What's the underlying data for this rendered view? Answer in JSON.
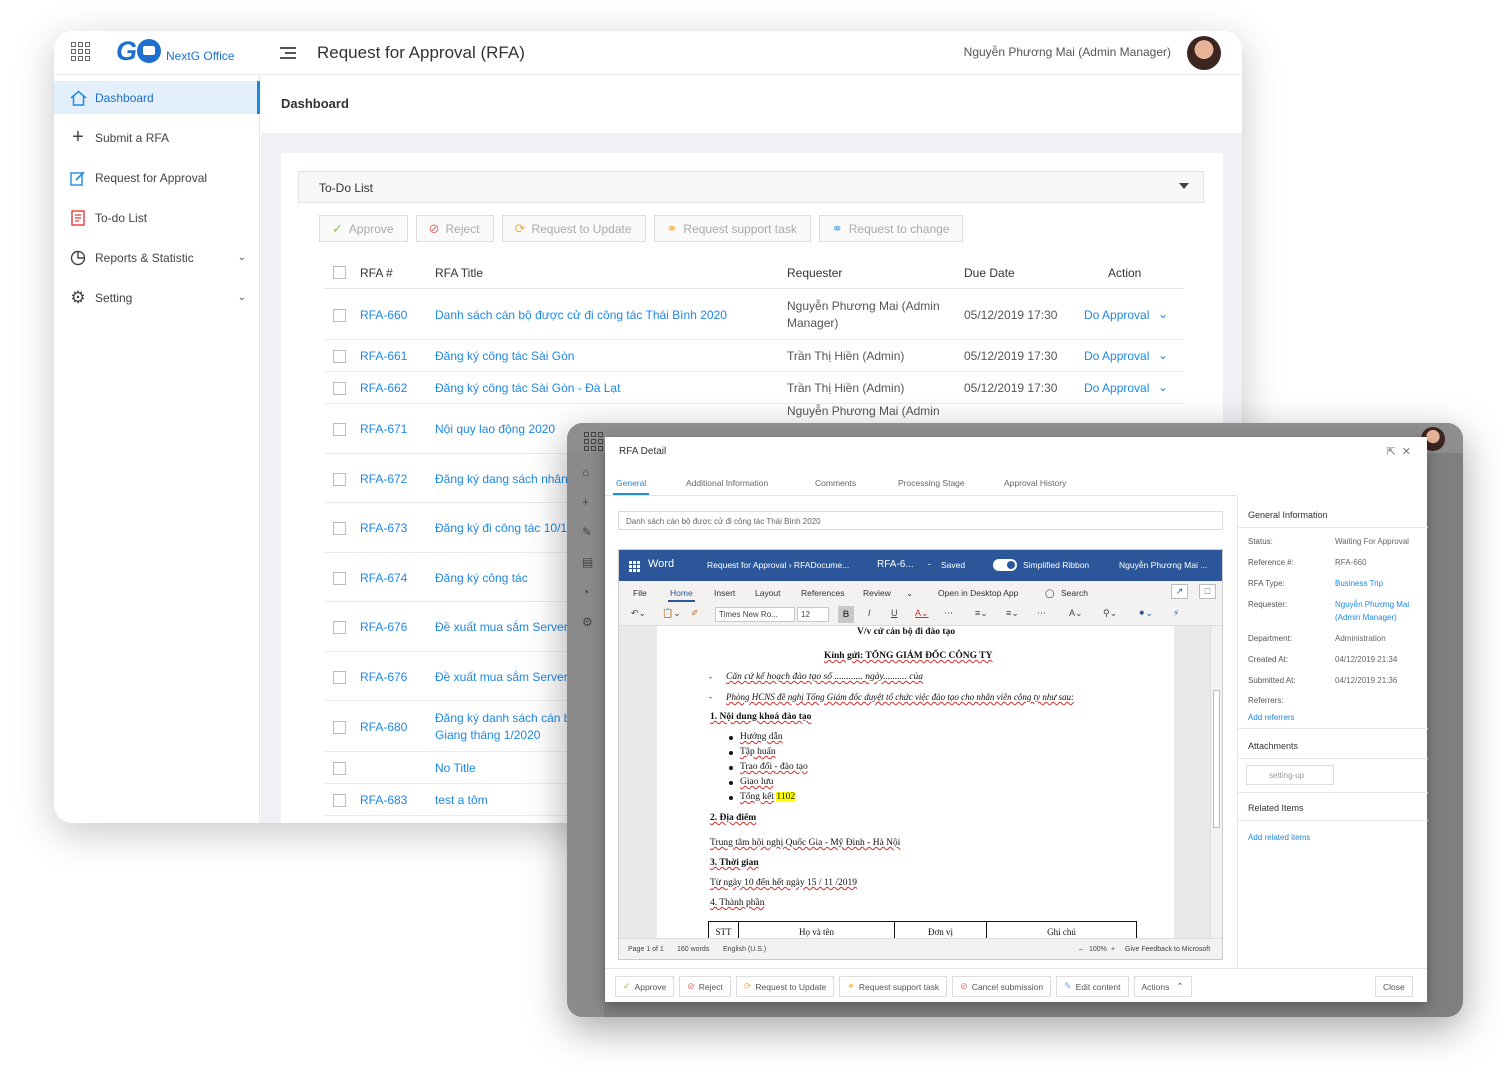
{
  "app": {
    "logo_text": "GO",
    "logo_name": "NextG Office",
    "title": "Request for Approval (RFA)",
    "user": "Nguyễn Phương Mai (Admin Manager)"
  },
  "sidebar": {
    "items": [
      {
        "label": "Dashboard",
        "icon": "home-icon"
      },
      {
        "label": "Submit a RFA",
        "icon": "plus-icon"
      },
      {
        "label": "Request for Approval",
        "icon": "edit-icon"
      },
      {
        "label": "To-do List",
        "icon": "list-icon"
      },
      {
        "label": "Reports & Statistic",
        "icon": "pie-chart-icon"
      },
      {
        "label": "Setting",
        "icon": "gear-icon"
      }
    ]
  },
  "dashboard": {
    "heading": "Dashboard",
    "todo_title": "To-Do List",
    "buttons": {
      "approve": "Approve",
      "reject": "Reject",
      "request_update": "Request to Update",
      "support_task": "Request support task",
      "request_change": "Request to change"
    },
    "columns": {
      "id": "RFA #",
      "title": "RFA Title",
      "requester": "Requester",
      "due": "Due Date",
      "action": "Action"
    },
    "rows": [
      {
        "id": "RFA-660",
        "title": "Danh sách cán bộ được cử đi công tác Thái Bình 2020",
        "requester_1": "Nguyễn Phương Mai (Admin",
        "requester_2": "Manager)",
        "due": "05/12/2019 17:30",
        "action": "Do Approval"
      },
      {
        "id": "RFA-661",
        "title": "Đăng ký công tác Sài Gòn",
        "requester_1": "Trần Thị Hiền (Admin)",
        "requester_2": "",
        "due": "05/12/2019 17:30",
        "action": "Do Approval"
      },
      {
        "id": "RFA-662",
        "title": "Đăng ký công tác Sài Gòn - Đà Lạt",
        "requester_1": "Trần Thị Hiền (Admin)",
        "requester_2": "",
        "due": "05/12/2019 17:30",
        "action": "Do Approval"
      },
      {
        "id": "RFA-671",
        "title": "Nội quy lao động 2020",
        "requester_1": "Nguyễn Phương Mai (Admin",
        "requester_2": "",
        "due": "",
        "action": ""
      },
      {
        "id": "RFA-672",
        "title": "Đăng ký dang sách nhân",
        "requester_1": "",
        "requester_2": "",
        "due": "",
        "action": ""
      },
      {
        "id": "RFA-673",
        "title": "Đăng ký đi công tác 10/1",
        "requester_1": "",
        "requester_2": "",
        "due": "",
        "action": ""
      },
      {
        "id": "RFA-674",
        "title": "Đăng ký công tác",
        "requester_1": "",
        "requester_2": "",
        "due": "",
        "action": ""
      },
      {
        "id": "RFA-676",
        "title": "Đề xuất mua sắm Server",
        "requester_1": "",
        "requester_2": "",
        "due": "",
        "action": ""
      },
      {
        "id": "RFA-676",
        "title": "Đề xuất mua sắm Server",
        "requester_1": "",
        "requester_2": "",
        "due": "",
        "action": ""
      },
      {
        "id": "RFA-680",
        "title": "Đăng ký danh sách cán b",
        "title_2": "Giang tháng 1/2020",
        "requester_1": "",
        "requester_2": "",
        "due": "",
        "action": ""
      },
      {
        "id": "",
        "title": "No Title",
        "requester_1": "",
        "requester_2": "",
        "due": "",
        "action": ""
      },
      {
        "id": "RFA-683",
        "title": "test a tôm",
        "requester_1": "",
        "requester_2": "",
        "due": "",
        "action": ""
      }
    ]
  },
  "modal": {
    "title": "RFA Detail",
    "tabs": [
      "General",
      "Additional Information",
      "Comments",
      "Processing Stage",
      "Approval History"
    ],
    "subject": "Danh sách cán bộ được cử đi công tác Thái Bình 2020",
    "word": {
      "app": "Word",
      "crumb": "Request for Approval › RFADocume...",
      "file": "RFA-6...",
      "dash": "-",
      "saved": "Saved",
      "ribbon_label": "Simplified Ribbon",
      "user": "Nguyễn Phương Mai ...",
      "menu": [
        "File",
        "Home",
        "Insert",
        "Layout",
        "References",
        "Review",
        "Open in Desktop App",
        "Search"
      ],
      "font": "Times New Ro...",
      "size": "12",
      "status_page": "Page 1 of 1",
      "status_words": "160 words",
      "status_lang": "English (U.S.)",
      "status_zoom": "100%",
      "status_feedback": "Give Feedback to Microsoft"
    },
    "doc": {
      "l1": "V/v cử cán bộ đi đào tạo",
      "l2": "Kính gửi: TỔNG GIÁM ĐỐC CÔNG TY",
      "l3": "Căn cứ kế hoạch đào tạo số ............ ngày.......... của",
      "l4": "Phòng HCNS đề nghị Tổng Giám đốc duyệt tổ chức việc đào tạo cho nhân viên công ty như sau:",
      "h1": "1. Nội dung khoá đào tạo",
      "b1": "Hướng dẫn",
      "b2": "Tập huấn",
      "b3": "Trao đổi - đào tạo",
      "b4": "Giao lưu",
      "b5": "Tổng kết",
      "b5_hl": "1102",
      "h2": "2. Địa điểm",
      "p2": "Trung tâm hội nghị Quốc Gia - Mỹ Đình - Hà Nội",
      "h3": "3. Thời gian",
      "p3": "Từ ngày 10 đến hết ngày 15 / 11 /2019",
      "h4": "4. Thành phần",
      "th": [
        "STT",
        "Họ và tên",
        "Đơn vị",
        "Ghi chú"
      ]
    },
    "general": {
      "heading": "General Information",
      "status_k": "Status:",
      "status_v": "Waiting For Approval",
      "ref_k": "Reference #:",
      "ref_v": "RFA-660",
      "type_k": "RFA Type:",
      "type_v": "Business Trip",
      "req_k": "Requester:",
      "req_v1": "Nguyễn Phương Mai",
      "req_v2": "(Admin Manager)",
      "dept_k": "Department:",
      "dept_v": "Administration",
      "created_k": "Created At:",
      "created_v": "04/12/2019 21:34",
      "submitted_k": "Submitted At:",
      "submitted_v": "04/12/2019 21:36",
      "referrers_k": "Referrers:",
      "add_referrers": "Add referrers",
      "attachments": "Attachments",
      "attachment_chip": "setting-up",
      "related": "Related Items",
      "add_related": "Add related items"
    },
    "footer": {
      "approve": "Approve",
      "reject": "Reject",
      "request_update": "Request to Update",
      "support_task": "Request support task",
      "cancel": "Cancel submission",
      "edit": "Edit content",
      "actions": "Actions",
      "close": "Close"
    }
  },
  "colors": {
    "accent": "#1e88e5",
    "word_blue": "#2b579a",
    "highlight": "#ffff00"
  }
}
